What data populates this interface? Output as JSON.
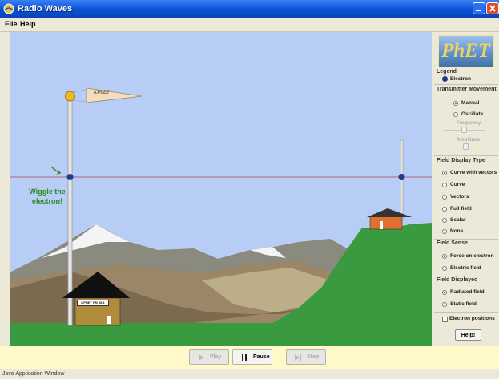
{
  "window": {
    "title": "Radio Waves",
    "status": "Java Application Window"
  },
  "menu": {
    "file": "File",
    "help": "Help"
  },
  "canvas": {
    "wiggle_text_line1": "Wiggle the",
    "wiggle_text_line2": "electron!",
    "flag_text": "KPhET",
    "house_sign": "KPHET FM 98.1"
  },
  "panel": {
    "logo_text": "PhET",
    "legend_title": "Legend",
    "legend_electron": "Electron",
    "transmitter_title": "Transmitter Movement",
    "manual": "Manual",
    "oscillate": "Oscillate",
    "frequency": "Frequency",
    "amplitude": "Amplitude",
    "field_display_title": "Field Display Type",
    "display_options": [
      "Curve with vectors",
      "Curve",
      "Vectors",
      "Full field",
      "Scalar",
      "None"
    ],
    "display_selected": "Curve with vectors",
    "field_sense_title": "Field Sense",
    "sense_options": [
      "Force on electron",
      "Electric field"
    ],
    "field_displayed_title": "Field Displayed",
    "displayed_options": [
      "Radiated field",
      "Static field"
    ],
    "electron_positions": "Electron positions",
    "help_button": "Help!"
  },
  "controls": {
    "play": "Play",
    "pause": "Pause",
    "step": "Step"
  },
  "colors": {
    "sky": "#b7cdf5",
    "grass": "#3a9a3f",
    "accent": "#1b3c8a",
    "control_bar": "#fff9c9"
  }
}
